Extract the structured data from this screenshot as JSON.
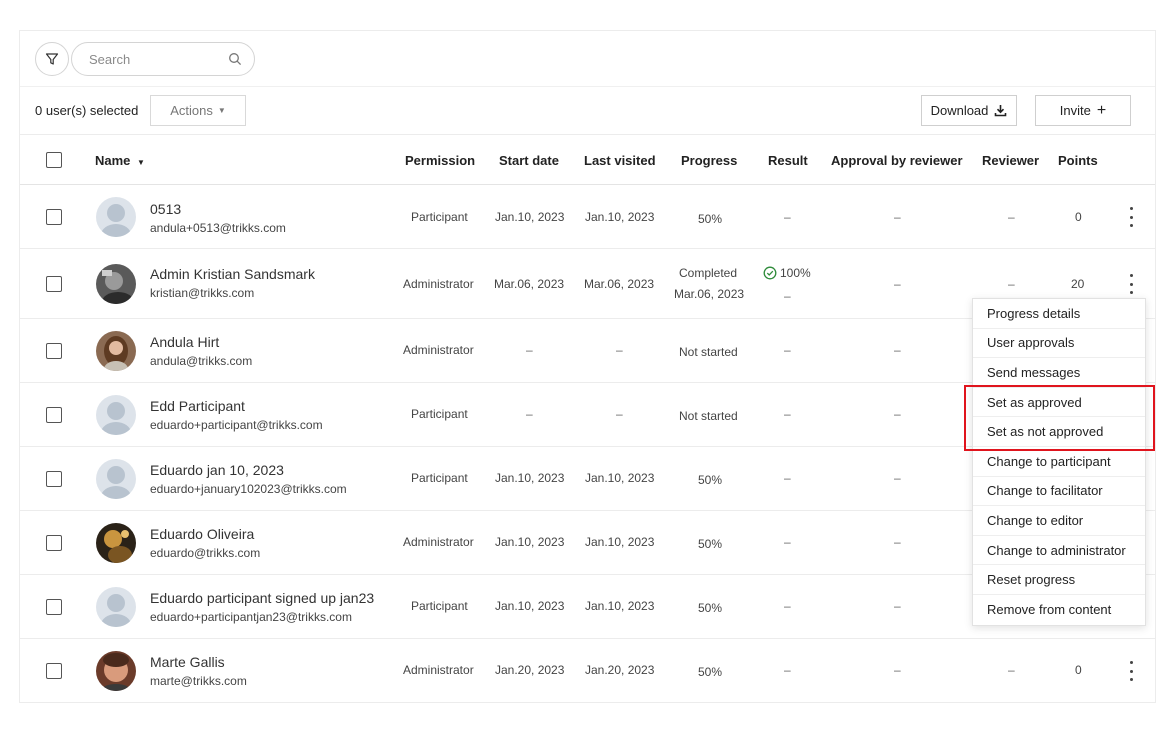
{
  "toolbar": {
    "search_placeholder": "Search",
    "selected_count": "0 user(s) selected",
    "actions_label": "Actions",
    "download_label": "Download",
    "invite_label": "Invite"
  },
  "columns": {
    "name": "Name",
    "permission": "Permission",
    "start_date": "Start date",
    "last_visited": "Last visited",
    "progress": "Progress",
    "result": "Result",
    "approval": "Approval by reviewer",
    "reviewer": "Reviewer",
    "points": "Points"
  },
  "rows": [
    {
      "name": "0513",
      "email": "andula+0513@trikks.com",
      "permission": "Participant",
      "start": "Jan.10, 2023",
      "last": "Jan.10, 2023",
      "progress": "50%",
      "result": "–",
      "approval": "–",
      "reviewer": "–",
      "points": "0"
    },
    {
      "name": "Admin Kristian Sandsmark",
      "email": "kristian@trikks.com",
      "permission": "Administrator",
      "start": "Mar.06, 2023",
      "last": "Mar.06, 2023",
      "progress": "Completed",
      "progress2": "Mar.06, 2023",
      "result": "100%",
      "result2": "–",
      "approval": "–",
      "reviewer": "–",
      "points": "20"
    },
    {
      "name": "Andula Hirt",
      "email": "andula@trikks.com",
      "permission": "Administrator",
      "start": "–",
      "last": "–",
      "progress": "Not started",
      "result": "–",
      "approval": "–",
      "reviewer": "",
      "points": ""
    },
    {
      "name": "Edd Participant",
      "email": "eduardo+participant@trikks.com",
      "permission": "Participant",
      "start": "–",
      "last": "–",
      "progress": "Not started",
      "result": "–",
      "approval": "–",
      "reviewer": "",
      "points": ""
    },
    {
      "name": "Eduardo jan 10, 2023",
      "email": "eduardo+january102023@trikks.com",
      "permission": "Participant",
      "start": "Jan.10, 2023",
      "last": "Jan.10, 2023",
      "progress": "50%",
      "result": "–",
      "approval": "–",
      "reviewer": "",
      "points": ""
    },
    {
      "name": "Eduardo Oliveira",
      "email": "eduardo@trikks.com",
      "permission": "Administrator",
      "start": "Jan.10, 2023",
      "last": "Jan.10, 2023",
      "progress": "50%",
      "result": "–",
      "approval": "–",
      "reviewer": "",
      "points": ""
    },
    {
      "name": "Eduardo participant signed up jan23",
      "email": "eduardo+participantjan23@trikks.com",
      "permission": "Participant",
      "start": "Jan.10, 2023",
      "last": "Jan.10, 2023",
      "progress": "50%",
      "result": "–",
      "approval": "–",
      "reviewer": "",
      "points": ""
    },
    {
      "name": "Marte Gallis",
      "email": "marte@trikks.com",
      "permission": "Administrator",
      "start": "Jan.20, 2023",
      "last": "Jan.20, 2023",
      "progress": "50%",
      "result": "–",
      "approval": "–",
      "reviewer": "–",
      "points": "0"
    }
  ],
  "menu": {
    "items": [
      "Progress details",
      "User approvals",
      "Send messages",
      "Set as approved",
      "Set as not approved",
      "Change to participant",
      "Change to facilitator",
      "Change to editor",
      "Change to administrator",
      "Reset progress",
      "Remove from content"
    ]
  },
  "colors": {
    "highlight": "#e0141d",
    "success": "#2e8b3a"
  }
}
